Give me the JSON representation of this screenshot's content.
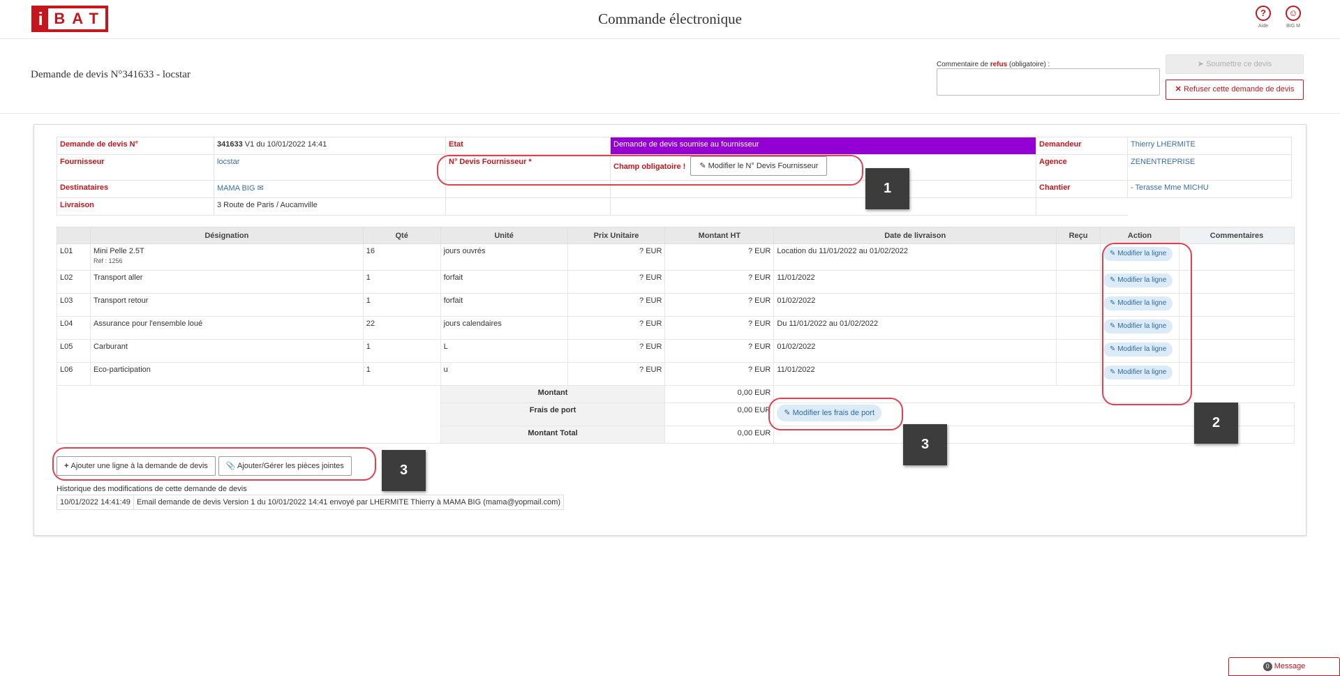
{
  "app": {
    "logo_letter": "i",
    "logo_rest": "BAT",
    "title": "Commande électronique"
  },
  "topbar": {
    "help_label": "Aide",
    "help_glyph": "?",
    "user_label": "BIG M",
    "user_glyph": "☺"
  },
  "header": {
    "page_title": "Demande de devis N°341633 - locstar",
    "comment_label_prefix": "Commentaire de ",
    "comment_label_bold": "refus",
    "comment_label_suffix": " (obligatoire) :",
    "comment_value": "",
    "submit_label": "Soumettre ce devis",
    "refuse_label": "Refuser cette demande de devis"
  },
  "info": {
    "demande_label": "Demande de devis N°",
    "demande_number": "341633",
    "demande_version": " V1 du 10/01/2022 14:41",
    "etat_label": "Etat",
    "etat_value": "Demande de devis soumise au fournisseur",
    "demandeur_label": "Demandeur",
    "demandeur_value": "Thierry LHERMITE",
    "fournisseur_label": "Fournisseur",
    "fournisseur_value": "locstar",
    "ndevis_label": "N° Devis Fournisseur *",
    "champ_obligatoire": "Champ obligatoire !",
    "modifier_ndevis_label": "Modifier le N° Devis Fournisseur",
    "agence_label": "Agence",
    "agence_value": "ZENENTREPRISE",
    "destinataires_label": "Destinataires",
    "destinataires_value": "MAMA BIG",
    "chantier_label": "Chantier",
    "chantier_value": "- Terasse Mme MICHU",
    "livraison_label": "Livraison",
    "livraison_value": "3 Route de Paris / Aucamville"
  },
  "lines": {
    "headers": [
      "Désignation",
      "Qté",
      "Unité",
      "Prix Unitaire",
      "Montant HT",
      "Date de livraison",
      "Reçu",
      "Action",
      "Commentaires"
    ],
    "action_label": "Modifier la ligne",
    "rows": [
      {
        "code": "L01",
        "designation": "Mini Pelle 2.5T",
        "ref": "Réf : 1256",
        "qty": "16",
        "unit": "jours ouvrés",
        "pu": "? EUR",
        "ht": "? EUR",
        "date": "Location du 11/01/2022 au 01/02/2022"
      },
      {
        "code": "L02",
        "designation": "Transport aller",
        "ref": "",
        "qty": "1",
        "unit": "forfait",
        "pu": "? EUR",
        "ht": "? EUR",
        "date": "11/01/2022"
      },
      {
        "code": "L03",
        "designation": "Transport retour",
        "ref": "",
        "qty": "1",
        "unit": "forfait",
        "pu": "? EUR",
        "ht": "? EUR",
        "date": "01/02/2022"
      },
      {
        "code": "L04",
        "designation": "Assurance pour l'ensemble loué",
        "ref": "",
        "qty": "22",
        "unit": "jours calendaires",
        "pu": "? EUR",
        "ht": "? EUR",
        "date": "Du 11/01/2022 au 01/02/2022"
      },
      {
        "code": "L05",
        "designation": "Carburant",
        "ref": "",
        "qty": "1",
        "unit": "L",
        "pu": "? EUR",
        "ht": "? EUR",
        "date": "01/02/2022"
      },
      {
        "code": "L06",
        "designation": "Eco-participation",
        "ref": "",
        "qty": "1",
        "unit": "u",
        "pu": "? EUR",
        "ht": "? EUR",
        "date": "11/01/2022"
      }
    ],
    "totals": {
      "montant_label": "Montant",
      "montant_value": "0,00 EUR",
      "frais_label": "Frais de port",
      "frais_value": "0,00 EUR",
      "modifier_frais_label": "Modifier les frais de port",
      "total_label": "Montant Total",
      "total_value": "0,00 EUR"
    }
  },
  "buttons": {
    "add_line_label": "Ajouter une ligne à la demande de devis",
    "attachments_label": "Ajouter/Gérer les pièces jointes"
  },
  "history": {
    "title": "Historique des modifications de cette demande de devis",
    "entries": [
      {
        "date": "10/01/2022 14:41:49",
        "text": "Email demande de devis Version 1 du 10/01/2022 14:41 envoyé par LHERMITE Thierry à MAMA BIG (mama@yopmail.com)"
      }
    ]
  },
  "annotations": {
    "one": "1",
    "two": "2",
    "three_a": "3",
    "three_b": "3"
  },
  "message": {
    "count": "0",
    "label": "Message"
  },
  "colors": {
    "brand": "#c4161c",
    "etat": "#9400d3",
    "link": "#3a6ea5",
    "annotation": "#e04050"
  }
}
